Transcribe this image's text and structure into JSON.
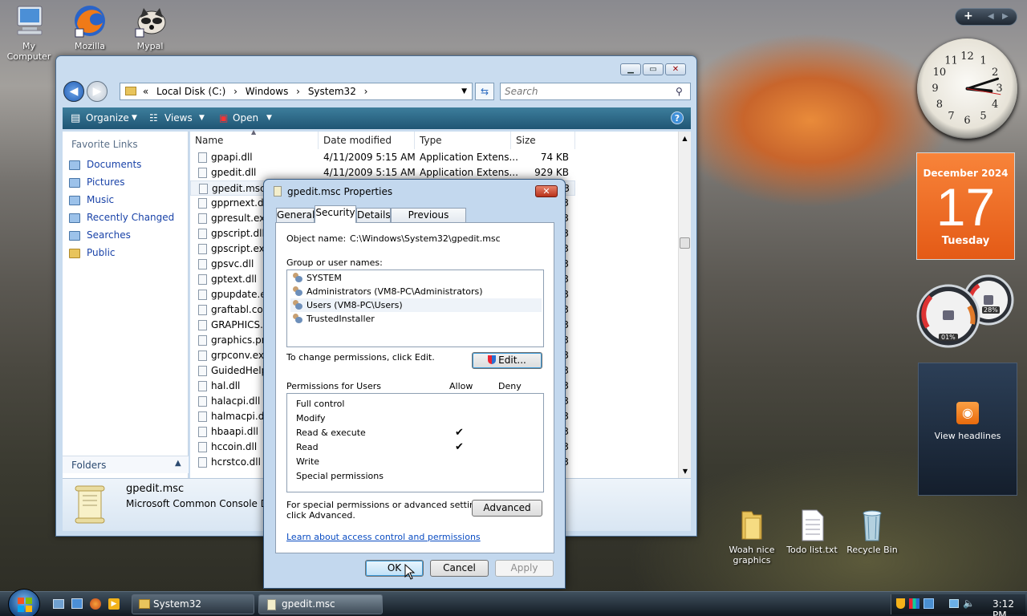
{
  "desktop": {
    "icons": [
      {
        "label1": "My",
        "label2": "Computer"
      },
      {
        "label1": "Mozilla",
        "label2": ""
      },
      {
        "label1": "Mypal",
        "label2": ""
      }
    ],
    "bottom_icons": [
      {
        "label1": "Woah nice",
        "label2": "graphics"
      },
      {
        "label1": "Todo list.txt",
        "label2": ""
      },
      {
        "label1": "Recycle Bin",
        "label2": ""
      }
    ]
  },
  "explorer": {
    "address": [
      "«",
      "Local Disk (C:)",
      "›",
      "Windows",
      "›",
      "System32",
      "›"
    ],
    "search_placeholder": "Search",
    "toolbar": {
      "organize": "Organize",
      "views": "Views",
      "open": "Open"
    },
    "favorite_links_title": "Favorite Links",
    "links": [
      "Documents",
      "Pictures",
      "Music",
      "Recently Changed",
      "Searches",
      "Public"
    ],
    "folders_label": "Folders",
    "columns": [
      "Name",
      "Date modified",
      "Type",
      "Size"
    ],
    "files": [
      {
        "name": "gpapi.dll",
        "date": "4/11/2009 5:15 AM",
        "type": "Application Extens...",
        "size": "74 KB"
      },
      {
        "name": "gpedit.dll",
        "date": "4/11/2009 5:15 AM",
        "type": "Application Extens...",
        "size": "929 KB"
      },
      {
        "name": "gpedit.msc"
      },
      {
        "name": "gpprnext.dll"
      },
      {
        "name": "gpresult.exe"
      },
      {
        "name": "gpscript.dll"
      },
      {
        "name": "gpscript.exe"
      },
      {
        "name": "gpsvc.dll"
      },
      {
        "name": "gptext.dll"
      },
      {
        "name": "gpupdate.ex"
      },
      {
        "name": "graftabl.com"
      },
      {
        "name": "GRAPHICS.C"
      },
      {
        "name": "graphics.pro"
      },
      {
        "name": "grpconv.exe"
      },
      {
        "name": "GuidedHelp."
      },
      {
        "name": "hal.dll"
      },
      {
        "name": "halacpi.dll"
      },
      {
        "name": "halmacpi.dll"
      },
      {
        "name": "hbaapi.dll"
      },
      {
        "name": "hccoin.dll"
      },
      {
        "name": "hcrstco.dll"
      }
    ],
    "size_fragments": [
      "3",
      "3",
      "3",
      "3",
      "3",
      "3",
      "3",
      "3",
      "3",
      "3",
      "3",
      "3",
      "3",
      "3",
      "3",
      "3",
      "3",
      "3",
      "3"
    ],
    "details": {
      "name": "gpedit.msc",
      "type": "Microsoft Common Console Do"
    }
  },
  "dialog": {
    "title": "gpedit.msc Properties",
    "tabs": [
      "General",
      "Security",
      "Details",
      "Previous Versions"
    ],
    "object_name_label": "Object name:",
    "object_name": "C:\\Windows\\System32\\gpedit.msc",
    "group_label": "Group or user names:",
    "users": [
      "SYSTEM",
      "Administrators (VM8-PC\\Administrators)",
      "Users (VM8-PC\\Users)",
      "TrustedInstaller"
    ],
    "change_text": "To change permissions, click Edit.",
    "edit_button": "Edit...",
    "perm_label": "Permissions for Users",
    "allow": "Allow",
    "deny": "Deny",
    "permissions": [
      "Full control",
      "Modify",
      "Read & execute",
      "Read",
      "Write",
      "Special permissions"
    ],
    "check": "✔",
    "advanced_text1": "For special permissions or advanced settings,",
    "advanced_text2": "click Advanced.",
    "advanced_button": "Advanced",
    "learn_link": "Learn about access control and permissions",
    "ok": "OK",
    "cancel": "Cancel",
    "apply": "Apply"
  },
  "gadgets": {
    "clock_numbers": [
      "12",
      "1",
      "2",
      "3",
      "4",
      "5",
      "6",
      "7",
      "8",
      "9",
      "10",
      "11"
    ],
    "calendar": {
      "month": "December 2024",
      "day": "17",
      "weekday": "Tuesday"
    },
    "cpu": "01%",
    "mem": "28%",
    "feeds": "View headlines"
  },
  "taskbar": {
    "tasks": [
      "System32",
      "gpedit.msc Properties"
    ],
    "time": "3:12 PM"
  }
}
